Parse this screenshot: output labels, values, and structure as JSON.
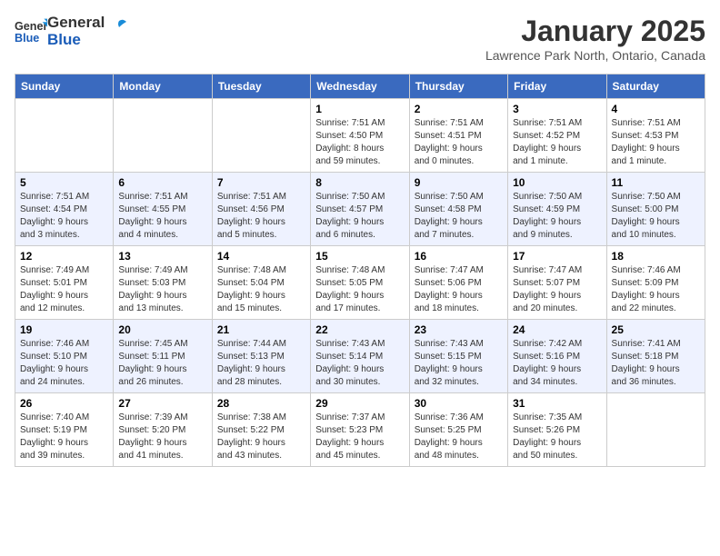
{
  "header": {
    "logo_line1": "General",
    "logo_line2": "Blue",
    "month": "January 2025",
    "location": "Lawrence Park North, Ontario, Canada"
  },
  "days_of_week": [
    "Sunday",
    "Monday",
    "Tuesday",
    "Wednesday",
    "Thursday",
    "Friday",
    "Saturday"
  ],
  "weeks": [
    [
      {
        "day": "",
        "info": ""
      },
      {
        "day": "",
        "info": ""
      },
      {
        "day": "",
        "info": ""
      },
      {
        "day": "1",
        "info": "Sunrise: 7:51 AM\nSunset: 4:50 PM\nDaylight: 8 hours\nand 59 minutes."
      },
      {
        "day": "2",
        "info": "Sunrise: 7:51 AM\nSunset: 4:51 PM\nDaylight: 9 hours\nand 0 minutes."
      },
      {
        "day": "3",
        "info": "Sunrise: 7:51 AM\nSunset: 4:52 PM\nDaylight: 9 hours\nand 1 minute."
      },
      {
        "day": "4",
        "info": "Sunrise: 7:51 AM\nSunset: 4:53 PM\nDaylight: 9 hours\nand 1 minute."
      }
    ],
    [
      {
        "day": "5",
        "info": "Sunrise: 7:51 AM\nSunset: 4:54 PM\nDaylight: 9 hours\nand 3 minutes."
      },
      {
        "day": "6",
        "info": "Sunrise: 7:51 AM\nSunset: 4:55 PM\nDaylight: 9 hours\nand 4 minutes."
      },
      {
        "day": "7",
        "info": "Sunrise: 7:51 AM\nSunset: 4:56 PM\nDaylight: 9 hours\nand 5 minutes."
      },
      {
        "day": "8",
        "info": "Sunrise: 7:50 AM\nSunset: 4:57 PM\nDaylight: 9 hours\nand 6 minutes."
      },
      {
        "day": "9",
        "info": "Sunrise: 7:50 AM\nSunset: 4:58 PM\nDaylight: 9 hours\nand 7 minutes."
      },
      {
        "day": "10",
        "info": "Sunrise: 7:50 AM\nSunset: 4:59 PM\nDaylight: 9 hours\nand 9 minutes."
      },
      {
        "day": "11",
        "info": "Sunrise: 7:50 AM\nSunset: 5:00 PM\nDaylight: 9 hours\nand 10 minutes."
      }
    ],
    [
      {
        "day": "12",
        "info": "Sunrise: 7:49 AM\nSunset: 5:01 PM\nDaylight: 9 hours\nand 12 minutes."
      },
      {
        "day": "13",
        "info": "Sunrise: 7:49 AM\nSunset: 5:03 PM\nDaylight: 9 hours\nand 13 minutes."
      },
      {
        "day": "14",
        "info": "Sunrise: 7:48 AM\nSunset: 5:04 PM\nDaylight: 9 hours\nand 15 minutes."
      },
      {
        "day": "15",
        "info": "Sunrise: 7:48 AM\nSunset: 5:05 PM\nDaylight: 9 hours\nand 17 minutes."
      },
      {
        "day": "16",
        "info": "Sunrise: 7:47 AM\nSunset: 5:06 PM\nDaylight: 9 hours\nand 18 minutes."
      },
      {
        "day": "17",
        "info": "Sunrise: 7:47 AM\nSunset: 5:07 PM\nDaylight: 9 hours\nand 20 minutes."
      },
      {
        "day": "18",
        "info": "Sunrise: 7:46 AM\nSunset: 5:09 PM\nDaylight: 9 hours\nand 22 minutes."
      }
    ],
    [
      {
        "day": "19",
        "info": "Sunrise: 7:46 AM\nSunset: 5:10 PM\nDaylight: 9 hours\nand 24 minutes."
      },
      {
        "day": "20",
        "info": "Sunrise: 7:45 AM\nSunset: 5:11 PM\nDaylight: 9 hours\nand 26 minutes."
      },
      {
        "day": "21",
        "info": "Sunrise: 7:44 AM\nSunset: 5:13 PM\nDaylight: 9 hours\nand 28 minutes."
      },
      {
        "day": "22",
        "info": "Sunrise: 7:43 AM\nSunset: 5:14 PM\nDaylight: 9 hours\nand 30 minutes."
      },
      {
        "day": "23",
        "info": "Sunrise: 7:43 AM\nSunset: 5:15 PM\nDaylight: 9 hours\nand 32 minutes."
      },
      {
        "day": "24",
        "info": "Sunrise: 7:42 AM\nSunset: 5:16 PM\nDaylight: 9 hours\nand 34 minutes."
      },
      {
        "day": "25",
        "info": "Sunrise: 7:41 AM\nSunset: 5:18 PM\nDaylight: 9 hours\nand 36 minutes."
      }
    ],
    [
      {
        "day": "26",
        "info": "Sunrise: 7:40 AM\nSunset: 5:19 PM\nDaylight: 9 hours\nand 39 minutes."
      },
      {
        "day": "27",
        "info": "Sunrise: 7:39 AM\nSunset: 5:20 PM\nDaylight: 9 hours\nand 41 minutes."
      },
      {
        "day": "28",
        "info": "Sunrise: 7:38 AM\nSunset: 5:22 PM\nDaylight: 9 hours\nand 43 minutes."
      },
      {
        "day": "29",
        "info": "Sunrise: 7:37 AM\nSunset: 5:23 PM\nDaylight: 9 hours\nand 45 minutes."
      },
      {
        "day": "30",
        "info": "Sunrise: 7:36 AM\nSunset: 5:25 PM\nDaylight: 9 hours\nand 48 minutes."
      },
      {
        "day": "31",
        "info": "Sunrise: 7:35 AM\nSunset: 5:26 PM\nDaylight: 9 hours\nand 50 minutes."
      },
      {
        "day": "",
        "info": ""
      }
    ]
  ]
}
